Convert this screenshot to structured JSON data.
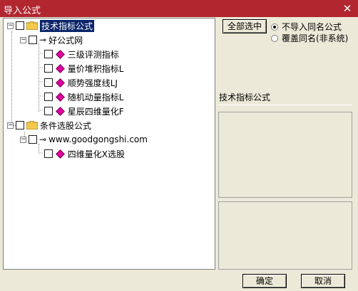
{
  "window": {
    "title": "导入公式",
    "close_glyph": "✕"
  },
  "tree": {
    "groups": [
      {
        "label": "技术指标公式",
        "selected": true,
        "sub": {
          "label": "好公式网",
          "items": [
            "三级评测指标",
            "量价堆积指标L",
            "顺势强度线LJ",
            "随机动量指标L",
            "星辰四维量化F"
          ]
        }
      },
      {
        "label": "条件选股公式",
        "selected": false,
        "sub": {
          "label": "www.goodgongshi.com",
          "items": [
            "四维量化X选股"
          ]
        }
      }
    ]
  },
  "options": {
    "select_all_label": "全部选中",
    "radio_options": [
      {
        "label": "不导入同名公式",
        "checked": true
      },
      {
        "label": "覆盖同名(非系统)",
        "checked": false
      }
    ]
  },
  "detail": {
    "section_label": "技术指标公式"
  },
  "buttons": {
    "ok_label": "确定",
    "cancel_label": "取消"
  },
  "colors": {
    "titlebar": "#B1262F",
    "dialog_bg": "#ECE9D8",
    "selection": "#0A246A",
    "item_icon": "#E000A0",
    "folder": "#F2C94C"
  }
}
